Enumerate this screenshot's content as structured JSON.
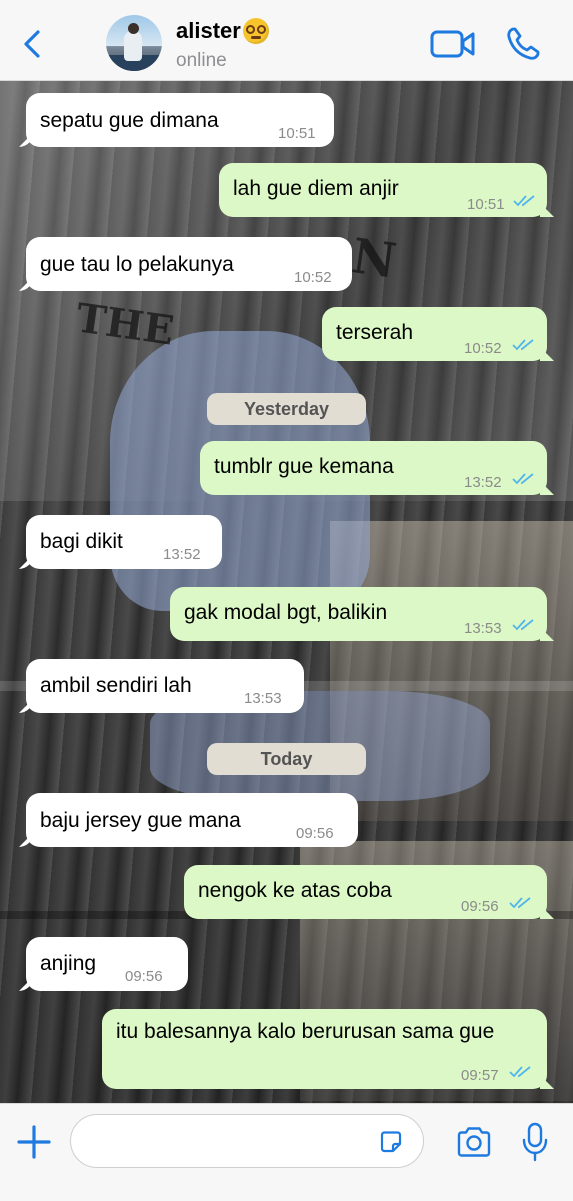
{
  "header": {
    "contact_name": "alister",
    "status": "online"
  },
  "messages": [
    {
      "dir": "in",
      "text": "sepatu gue dimana",
      "time": "10:51"
    },
    {
      "dir": "out",
      "text": "lah gue diem anjir",
      "time": "10:51"
    },
    {
      "dir": "in",
      "text": "gue tau lo pelakunya",
      "time": "10:52"
    },
    {
      "dir": "out",
      "text": "terserah",
      "time": "10:52"
    },
    {
      "date": "Yesterday"
    },
    {
      "dir": "out",
      "text": "tumblr gue kemana",
      "time": "13:52"
    },
    {
      "dir": "in",
      "text": "bagi dikit",
      "time": "13:52"
    },
    {
      "dir": "out",
      "text": "gak modal bgt, balikin",
      "time": "13:53"
    },
    {
      "dir": "in",
      "text": "ambil sendiri lah",
      "time": "13:53"
    },
    {
      "date": "Today"
    },
    {
      "dir": "in",
      "text": "baju jersey gue mana",
      "time": "09:56"
    },
    {
      "dir": "out",
      "text": "nengok ke atas coba",
      "time": "09:56"
    },
    {
      "dir": "in",
      "text": "anjing",
      "time": "09:56"
    },
    {
      "dir": "out",
      "text": "itu balesannya kalo berurusan sama gue",
      "time": "09:57"
    }
  ],
  "background_text": {
    "the": "THE",
    "n": "N"
  },
  "colors": {
    "accent": "#1f7ae0",
    "outgoing_bubble": "#dcf8c6",
    "incoming_bubble": "#ffffff",
    "read_ticks": "#4fb6ec"
  },
  "icons": {
    "back": "chevron-left-icon",
    "video": "video-call-icon",
    "phone": "phone-icon",
    "plus": "plus-icon",
    "sticker": "sticker-icon",
    "camera": "camera-icon",
    "mic": "microphone-icon"
  }
}
